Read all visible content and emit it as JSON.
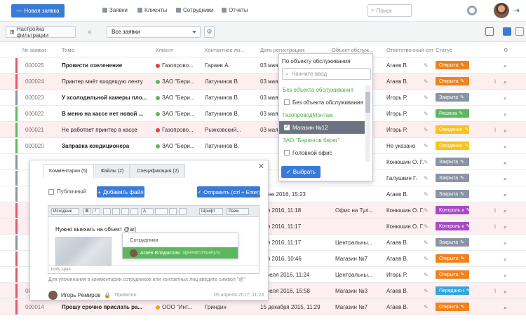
{
  "header": {
    "new_button": "Новая заявка",
    "nav": [
      "Заявки",
      "Клиенты",
      "Сотрудники",
      "Отчеты"
    ],
    "search_placeholder": "Поиск"
  },
  "toolbar": {
    "filter_button": "Настройка фильтрации",
    "select_value": "Все заявки"
  },
  "columns": {
    "num": "№ заявки",
    "subject": "Тема",
    "client": "Клиент",
    "contact": "Контактное ли...",
    "date": "Дата регистрации:",
    "object": "Объект обслуж...",
    "responsible": "Ответственный сот",
    "status": "Статус"
  },
  "rows": [
    {
      "num": "000025",
      "subject": "Провести озеленение",
      "client": "Газопрово...",
      "contact": "Гараев А.",
      "date": "03 мая",
      "resp": "Агаев В.",
      "status": "Открыта"
    },
    {
      "num": "000024",
      "subject": "Принтер мнёт входящую ленту",
      "client": "ЗАО \"Бери...",
      "contact": "Латунинов В.",
      "date": "03 мая",
      "resp": "Агаев В.",
      "status": "Открыта"
    },
    {
      "num": "000023",
      "subject": "У хсолодильной камеры пло...",
      "client": "ЗАО \"Бери...",
      "contact": "Латунинов В.",
      "date": "03 мая",
      "resp": "Игорь Р.",
      "status": "Закрыта"
    },
    {
      "num": "000022",
      "subject": "В меню на кассе нет новой ...",
      "client": "ЗАО \"Бери...",
      "contact": "Латунинов В.",
      "date": "03 мая",
      "resp": "Игорь Р.",
      "status": "Решена"
    },
    {
      "num": "000021",
      "subject": "Не работает принтер в кассе",
      "client": "Газопрово...",
      "contact": "Рыжковский...",
      "date": "03 мая",
      "resp": "Игорь Р.",
      "status": "Ожидание"
    },
    {
      "num": "000020",
      "subject": "Заправка кондиционера",
      "client": "ЗАО \"Бери...",
      "contact": "Латунинов В.",
      "date": "",
      "resp": "Не указано",
      "status": "Ожидание"
    },
    {
      "num": "",
      "subject": "",
      "client": "",
      "contact": "",
      "date": "",
      "resp": "Конюшин О. Г.",
      "status": "Закрыта"
    },
    {
      "num": "",
      "subject": "",
      "client": "",
      "contact": "",
      "date": "",
      "resp": "Галушкин Г.",
      "status": "Закрыта"
    },
    {
      "num": "",
      "subject": "",
      "client": "",
      "contact": "",
      "date": "мюне 2016, 15:23",
      "object": "",
      "resp": "Агаев В.",
      "status": "Закрыта"
    },
    {
      "num": "",
      "subject": "",
      "client": "",
      "contact": "",
      "date": "мая 2016, 11:18",
      "object": "Офис на Тул...",
      "resp": "Конюшин О. Г.",
      "status": "Контроль кач..."
    },
    {
      "num": "",
      "subject": "",
      "client": "",
      "contact": "",
      "date": "мая 2016, 11:17",
      "object": "",
      "resp": "Конюшин О. Г.",
      "status": "Контроль кач..."
    },
    {
      "num": "",
      "subject": "",
      "client": "",
      "contact": "",
      "date": "мая 2016, 11:17",
      "object": "Центральны...",
      "resp": "Агаев В.",
      "status": "Закрыта"
    },
    {
      "num": "",
      "subject": "",
      "client": "",
      "contact": "",
      "date": "мая 2016, 10:46",
      "object": "Магазин №7",
      "resp": "Агаев В.",
      "status": "Открыта"
    },
    {
      "num": "",
      "subject": "",
      "client": "",
      "contact": "",
      "date": "апреля 2016, 11:24",
      "object": "Центральны...",
      "resp": "Игорь Р.",
      "status": "Открыта"
    },
    {
      "num": "000015",
      "subject": "Не запускается Skype на рабо...",
      "client": "ООО \"Инт...",
      "contact": "Гриндин",
      "date": "апреля 2016, 15:58",
      "object": "Магазин №3",
      "resp": "Агаев В.",
      "status": "Передано в с..."
    },
    {
      "num": "000014",
      "subject": "Прошу срочно прислать ра...",
      "client": "ООО \"Инт...",
      "contact": "Гриндин",
      "date": "15 декабря 2015, 11:29",
      "object": "Магазин №7",
      "resp": "Агаев В.",
      "status": "Открыта"
    }
  ],
  "dropdown": {
    "title": "По объекту обслуживания",
    "search_placeholder": "Начните ввод",
    "items": [
      {
        "type": "group",
        "label": "Без объекта обслуживания"
      },
      {
        "type": "opt",
        "label": "Без объекта обслуживания",
        "checked": false
      },
      {
        "type": "group",
        "label": "ГазопроводМонтаж"
      },
      {
        "type": "opt",
        "label": "Магазин №12",
        "checked": true
      },
      {
        "type": "group",
        "label": "ЗАО \"Берингов берег\""
      },
      {
        "type": "opt",
        "label": "Головной офис",
        "checked": false
      }
    ],
    "choose_button": "Выбрать"
  },
  "panel": {
    "tabs": [
      "Комментарии (5)",
      "Файлы (2)",
      "Спецификация (2)"
    ],
    "public_label": "Публичный",
    "add_file": "Добавить файл",
    "send": "Отправить (ctrl + Enter)",
    "editor_text": "Нужно выехать на объект @ar|",
    "tools": [
      "Исходник",
      "B",
      "I",
      "",
      "",
      "",
      "",
      "A",
      "",
      "",
      "",
      "Шрифт",
      "Разм."
    ],
    "mention_header": "Сотрудники",
    "mention_name": "Агаев Владислав",
    "mention_email": "agaev@company.ru",
    "footer": "body  span",
    "hint": "Для упоминания в комментарии сотрудников или контактных лиц введите символ \"@\"",
    "author": "Игорь Ремиров",
    "privacy": "Приватно",
    "date": "05 апреля 2017, 11:23"
  },
  "colors": {
    "accent": "#3a7bd5",
    "open": "#f0821e",
    "closed": "#8a94a3",
    "solved": "#5cb85c",
    "waiting": "#f7c21a",
    "control": "#a54cc5",
    "transferred": "#34a4dd"
  }
}
